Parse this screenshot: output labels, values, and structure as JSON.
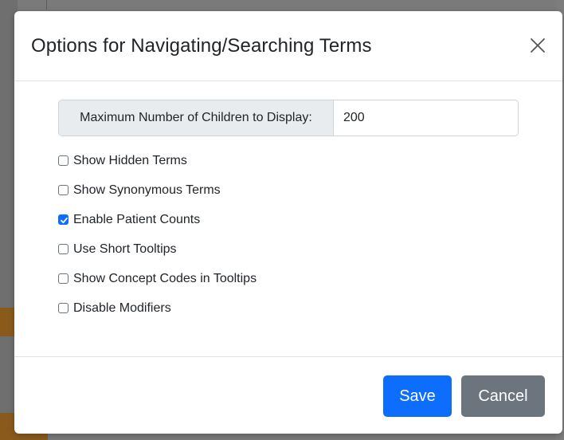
{
  "modal": {
    "title": "Options for Navigating/Searching Terms",
    "close_icon": "close-icon"
  },
  "max_children": {
    "label": "Maximum Number of Children to Display:",
    "value": "200"
  },
  "options": [
    {
      "label": "Show Hidden Terms",
      "checked": false
    },
    {
      "label": "Show Synonymous Terms",
      "checked": false
    },
    {
      "label": "Enable Patient Counts",
      "checked": true
    },
    {
      "label": "Use Short Tooltips",
      "checked": false
    },
    {
      "label": "Show Concept Codes in Tooltips",
      "checked": false
    },
    {
      "label": "Disable Modifiers",
      "checked": false
    }
  ],
  "footer": {
    "save_label": "Save",
    "cancel_label": "Cancel"
  },
  "colors": {
    "primary": "#0d6efd",
    "secondary": "#6c757d",
    "backdrop": "#7a7a7a"
  }
}
